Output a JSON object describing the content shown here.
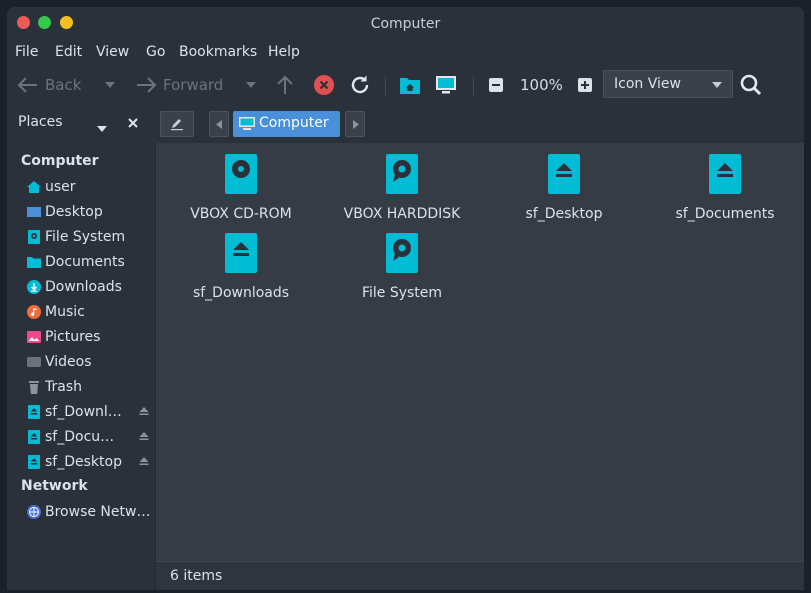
{
  "window": {
    "title": "Computer"
  },
  "menubar": [
    "File",
    "Edit",
    "View",
    "Go",
    "Bookmarks",
    "Help"
  ],
  "toolbar": {
    "back_label": "Back",
    "forward_label": "Forward",
    "zoom": "100%",
    "view_mode": "Icon View"
  },
  "sidebar": {
    "header": "Places",
    "section_computer": "Computer",
    "section_network": "Network",
    "items": [
      {
        "label": "user",
        "icon": "home-icon"
      },
      {
        "label": "Desktop",
        "icon": "desktop-folder-icon"
      },
      {
        "label": "File System",
        "icon": "drive-icon"
      },
      {
        "label": "Documents",
        "icon": "documents-folder-icon"
      },
      {
        "label": "Downloads",
        "icon": "download-icon"
      },
      {
        "label": "Music",
        "icon": "music-icon"
      },
      {
        "label": "Pictures",
        "icon": "pictures-icon"
      },
      {
        "label": "Videos",
        "icon": "videos-icon"
      },
      {
        "label": "Trash",
        "icon": "trash-icon"
      },
      {
        "label": "sf_Downl…",
        "icon": "removable-drive-icon"
      },
      {
        "label": "sf_Docu…",
        "icon": "removable-drive-icon"
      },
      {
        "label": "sf_Desktop",
        "icon": "removable-drive-icon"
      }
    ],
    "network_items": [
      {
        "label": "Browse Netw…",
        "icon": "network-icon"
      }
    ]
  },
  "pathbar": {
    "current": "Computer"
  },
  "files": [
    {
      "label": "VBOX CD-ROM",
      "icon": "optical-drive-icon"
    },
    {
      "label": "VBOX HARDDISK",
      "icon": "hard-disk-icon"
    },
    {
      "label": "sf_Desktop",
      "icon": "removable-drive-icon"
    },
    {
      "label": "sf_Documents",
      "icon": "removable-drive-icon"
    },
    {
      "label": "sf_Downloads",
      "icon": "removable-drive-icon"
    },
    {
      "label": "File System",
      "icon": "hard-disk-icon"
    }
  ],
  "status": {
    "text": "6 items"
  },
  "colors": {
    "accent": "#00bcd4",
    "selection": "#4a90d9",
    "stop": "#e05252"
  }
}
